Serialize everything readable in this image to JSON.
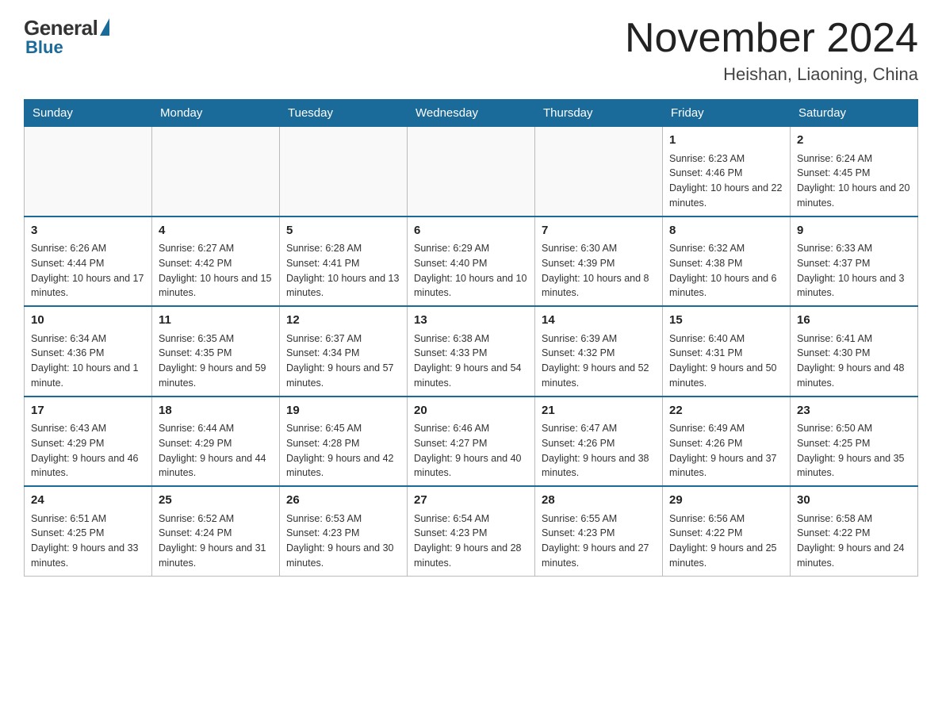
{
  "logo": {
    "general": "General",
    "blue": "Blue"
  },
  "title": "November 2024",
  "subtitle": "Heishan, Liaoning, China",
  "days_of_week": [
    "Sunday",
    "Monday",
    "Tuesday",
    "Wednesday",
    "Thursday",
    "Friday",
    "Saturday"
  ],
  "weeks": [
    [
      {
        "day": "",
        "sunrise": "",
        "sunset": "",
        "daylight": "",
        "empty": true
      },
      {
        "day": "",
        "sunrise": "",
        "sunset": "",
        "daylight": "",
        "empty": true
      },
      {
        "day": "",
        "sunrise": "",
        "sunset": "",
        "daylight": "",
        "empty": true
      },
      {
        "day": "",
        "sunrise": "",
        "sunset": "",
        "daylight": "",
        "empty": true
      },
      {
        "day": "",
        "sunrise": "",
        "sunset": "",
        "daylight": "",
        "empty": true
      },
      {
        "day": "1",
        "sunrise": "Sunrise: 6:23 AM",
        "sunset": "Sunset: 4:46 PM",
        "daylight": "Daylight: 10 hours and 22 minutes.",
        "empty": false
      },
      {
        "day": "2",
        "sunrise": "Sunrise: 6:24 AM",
        "sunset": "Sunset: 4:45 PM",
        "daylight": "Daylight: 10 hours and 20 minutes.",
        "empty": false
      }
    ],
    [
      {
        "day": "3",
        "sunrise": "Sunrise: 6:26 AM",
        "sunset": "Sunset: 4:44 PM",
        "daylight": "Daylight: 10 hours and 17 minutes.",
        "empty": false
      },
      {
        "day": "4",
        "sunrise": "Sunrise: 6:27 AM",
        "sunset": "Sunset: 4:42 PM",
        "daylight": "Daylight: 10 hours and 15 minutes.",
        "empty": false
      },
      {
        "day": "5",
        "sunrise": "Sunrise: 6:28 AM",
        "sunset": "Sunset: 4:41 PM",
        "daylight": "Daylight: 10 hours and 13 minutes.",
        "empty": false
      },
      {
        "day": "6",
        "sunrise": "Sunrise: 6:29 AM",
        "sunset": "Sunset: 4:40 PM",
        "daylight": "Daylight: 10 hours and 10 minutes.",
        "empty": false
      },
      {
        "day": "7",
        "sunrise": "Sunrise: 6:30 AM",
        "sunset": "Sunset: 4:39 PM",
        "daylight": "Daylight: 10 hours and 8 minutes.",
        "empty": false
      },
      {
        "day": "8",
        "sunrise": "Sunrise: 6:32 AM",
        "sunset": "Sunset: 4:38 PM",
        "daylight": "Daylight: 10 hours and 6 minutes.",
        "empty": false
      },
      {
        "day": "9",
        "sunrise": "Sunrise: 6:33 AM",
        "sunset": "Sunset: 4:37 PM",
        "daylight": "Daylight: 10 hours and 3 minutes.",
        "empty": false
      }
    ],
    [
      {
        "day": "10",
        "sunrise": "Sunrise: 6:34 AM",
        "sunset": "Sunset: 4:36 PM",
        "daylight": "Daylight: 10 hours and 1 minute.",
        "empty": false
      },
      {
        "day": "11",
        "sunrise": "Sunrise: 6:35 AM",
        "sunset": "Sunset: 4:35 PM",
        "daylight": "Daylight: 9 hours and 59 minutes.",
        "empty": false
      },
      {
        "day": "12",
        "sunrise": "Sunrise: 6:37 AM",
        "sunset": "Sunset: 4:34 PM",
        "daylight": "Daylight: 9 hours and 57 minutes.",
        "empty": false
      },
      {
        "day": "13",
        "sunrise": "Sunrise: 6:38 AM",
        "sunset": "Sunset: 4:33 PM",
        "daylight": "Daylight: 9 hours and 54 minutes.",
        "empty": false
      },
      {
        "day": "14",
        "sunrise": "Sunrise: 6:39 AM",
        "sunset": "Sunset: 4:32 PM",
        "daylight": "Daylight: 9 hours and 52 minutes.",
        "empty": false
      },
      {
        "day": "15",
        "sunrise": "Sunrise: 6:40 AM",
        "sunset": "Sunset: 4:31 PM",
        "daylight": "Daylight: 9 hours and 50 minutes.",
        "empty": false
      },
      {
        "day": "16",
        "sunrise": "Sunrise: 6:41 AM",
        "sunset": "Sunset: 4:30 PM",
        "daylight": "Daylight: 9 hours and 48 minutes.",
        "empty": false
      }
    ],
    [
      {
        "day": "17",
        "sunrise": "Sunrise: 6:43 AM",
        "sunset": "Sunset: 4:29 PM",
        "daylight": "Daylight: 9 hours and 46 minutes.",
        "empty": false
      },
      {
        "day": "18",
        "sunrise": "Sunrise: 6:44 AM",
        "sunset": "Sunset: 4:29 PM",
        "daylight": "Daylight: 9 hours and 44 minutes.",
        "empty": false
      },
      {
        "day": "19",
        "sunrise": "Sunrise: 6:45 AM",
        "sunset": "Sunset: 4:28 PM",
        "daylight": "Daylight: 9 hours and 42 minutes.",
        "empty": false
      },
      {
        "day": "20",
        "sunrise": "Sunrise: 6:46 AM",
        "sunset": "Sunset: 4:27 PM",
        "daylight": "Daylight: 9 hours and 40 minutes.",
        "empty": false
      },
      {
        "day": "21",
        "sunrise": "Sunrise: 6:47 AM",
        "sunset": "Sunset: 4:26 PM",
        "daylight": "Daylight: 9 hours and 38 minutes.",
        "empty": false
      },
      {
        "day": "22",
        "sunrise": "Sunrise: 6:49 AM",
        "sunset": "Sunset: 4:26 PM",
        "daylight": "Daylight: 9 hours and 37 minutes.",
        "empty": false
      },
      {
        "day": "23",
        "sunrise": "Sunrise: 6:50 AM",
        "sunset": "Sunset: 4:25 PM",
        "daylight": "Daylight: 9 hours and 35 minutes.",
        "empty": false
      }
    ],
    [
      {
        "day": "24",
        "sunrise": "Sunrise: 6:51 AM",
        "sunset": "Sunset: 4:25 PM",
        "daylight": "Daylight: 9 hours and 33 minutes.",
        "empty": false
      },
      {
        "day": "25",
        "sunrise": "Sunrise: 6:52 AM",
        "sunset": "Sunset: 4:24 PM",
        "daylight": "Daylight: 9 hours and 31 minutes.",
        "empty": false
      },
      {
        "day": "26",
        "sunrise": "Sunrise: 6:53 AM",
        "sunset": "Sunset: 4:23 PM",
        "daylight": "Daylight: 9 hours and 30 minutes.",
        "empty": false
      },
      {
        "day": "27",
        "sunrise": "Sunrise: 6:54 AM",
        "sunset": "Sunset: 4:23 PM",
        "daylight": "Daylight: 9 hours and 28 minutes.",
        "empty": false
      },
      {
        "day": "28",
        "sunrise": "Sunrise: 6:55 AM",
        "sunset": "Sunset: 4:23 PM",
        "daylight": "Daylight: 9 hours and 27 minutes.",
        "empty": false
      },
      {
        "day": "29",
        "sunrise": "Sunrise: 6:56 AM",
        "sunset": "Sunset: 4:22 PM",
        "daylight": "Daylight: 9 hours and 25 minutes.",
        "empty": false
      },
      {
        "day": "30",
        "sunrise": "Sunrise: 6:58 AM",
        "sunset": "Sunset: 4:22 PM",
        "daylight": "Daylight: 9 hours and 24 minutes.",
        "empty": false
      }
    ]
  ]
}
